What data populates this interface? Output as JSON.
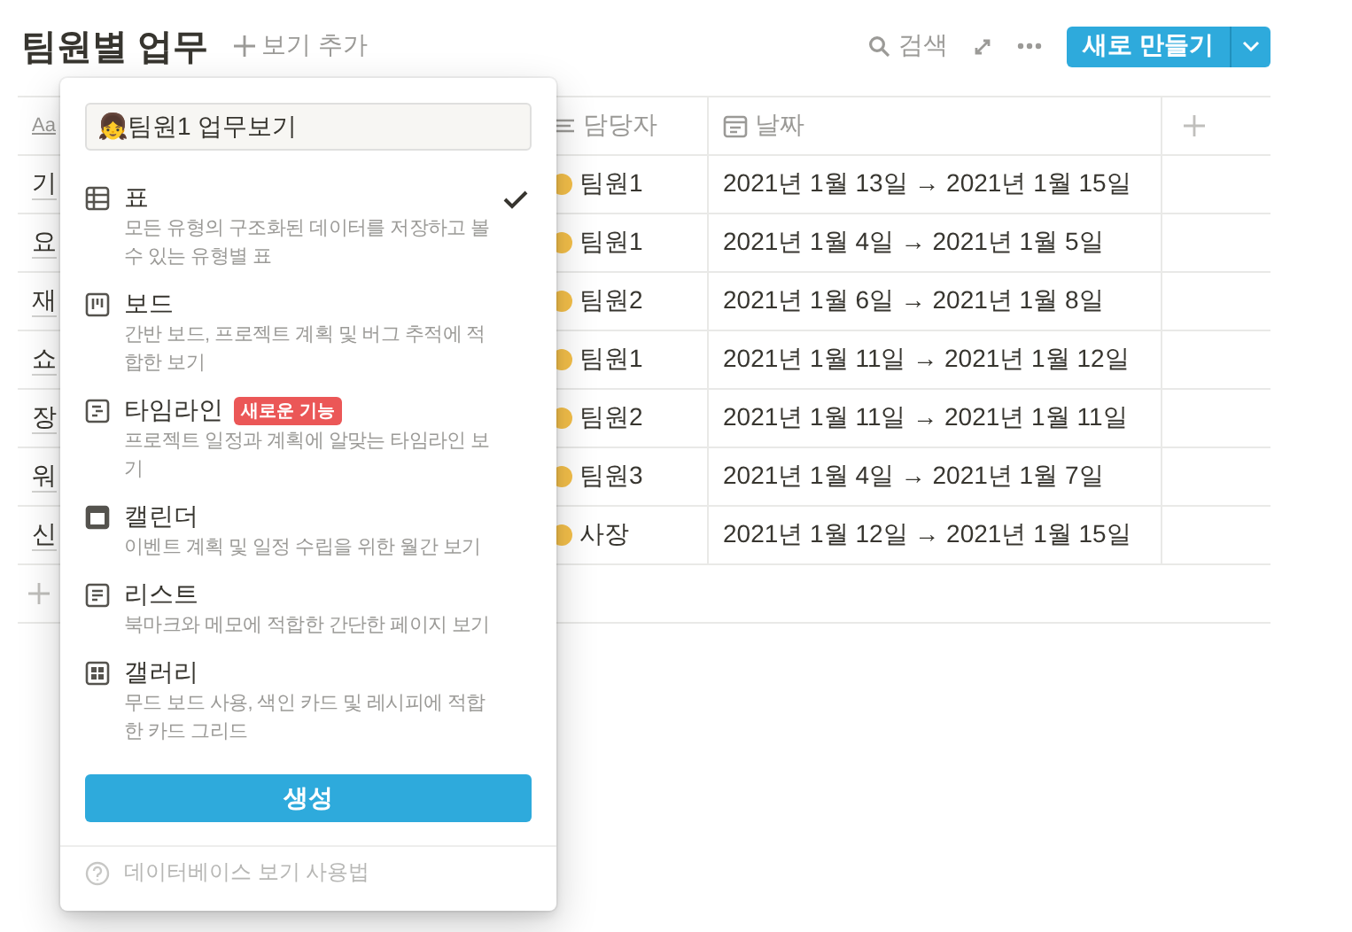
{
  "header": {
    "title": "팀원별 업무",
    "add_view": "보기 추가",
    "search": "검색",
    "new_button": "새로 만들기"
  },
  "table": {
    "columns": [
      {
        "kind": "title",
        "icon_text": "Aa"
      },
      {
        "kind": "person",
        "label": "담당자"
      },
      {
        "kind": "date",
        "label": "날짜"
      }
    ],
    "rows": [
      {
        "title": "기",
        "assignee": "팀원1",
        "date": "2021년 1월 13일 → 2021년 1월 15일"
      },
      {
        "title": "요",
        "assignee": "팀원1",
        "date": "2021년 1월 4일 → 2021년 1월 5일"
      },
      {
        "title": "재",
        "assignee": "팀원2",
        "date": "2021년 1월 6일 → 2021년 1월 8일"
      },
      {
        "title": "쇼",
        "assignee": "팀원1",
        "date": "2021년 1월 11일 → 2021년 1월 12일"
      },
      {
        "title": "장",
        "assignee": "팀원2",
        "date": "2021년 1월 11일 → 2021년 1월 11일"
      },
      {
        "title": "워",
        "assignee": "팀원3",
        "date": "2021년 1월 4일 → 2021년 1월 7일"
      },
      {
        "title": "신",
        "assignee": "사장",
        "date": "2021년 1월 12일 → 2021년 1월 15일"
      }
    ]
  },
  "popup": {
    "view_name": "👧팀원1 업무보기",
    "view_types": [
      {
        "kind": "table",
        "title": "표",
        "description": "모든 유형의 구조화된 데이터를 저장하고 볼 수 있는 유형별 표",
        "selected": true
      },
      {
        "kind": "board",
        "title": "보드",
        "description": "간반 보드, 프로젝트 계획 및 버그 추적에 적합한 보기",
        "selected": false
      },
      {
        "kind": "timeline",
        "title": "타임라인",
        "badge": "새로운 기능",
        "description": "프로젝트 일정과 계획에 알맞는 타임라인 보기",
        "selected": false
      },
      {
        "kind": "calendar",
        "title": "캘린더",
        "description": "이벤트 계획 및 일정 수립을 위한 월간 보기",
        "selected": false
      },
      {
        "kind": "list",
        "title": "리스트",
        "description": "북마크와 메모에 적합한 간단한 페이지 보기",
        "selected": false
      },
      {
        "kind": "gallery",
        "title": "갤러리",
        "description": "무드 보드 사용, 색인 카드 및 레시피에 적합한 카드 그리드",
        "selected": false
      }
    ],
    "create_button": "생성",
    "help": "데이터베이스 보기 사용법"
  }
}
